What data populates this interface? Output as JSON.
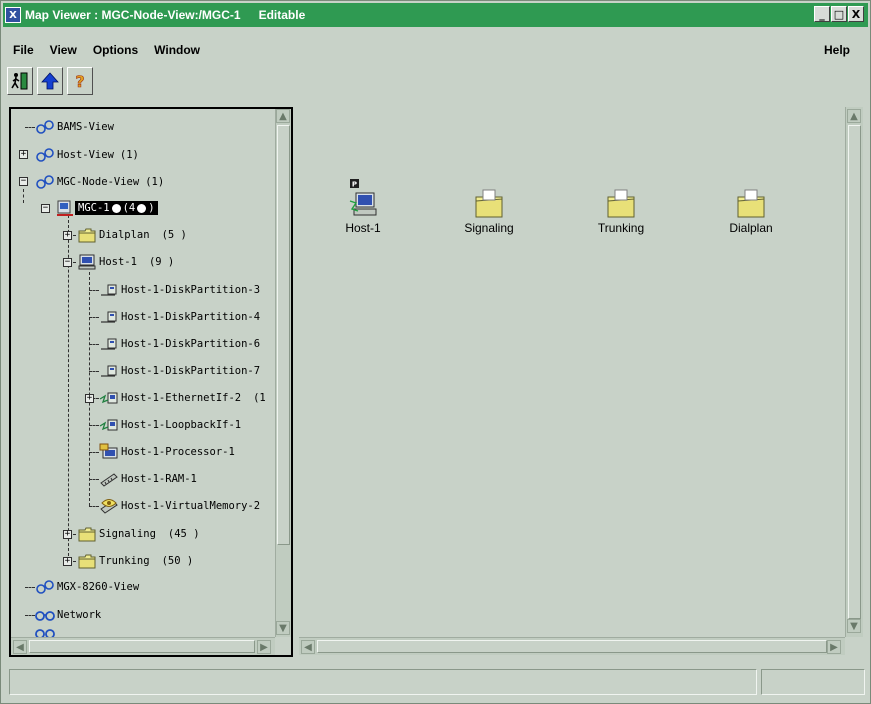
{
  "window": {
    "title": "Map Viewer : MGC-Node-View:/MGC-1",
    "status": "Editable",
    "logo": "X",
    "minimize": "_",
    "maximize": "□",
    "close": "X"
  },
  "menu": {
    "file": "File",
    "view": "View",
    "options": "Options",
    "window": "Window",
    "help": "Help"
  },
  "toolbar": {
    "items": [
      {
        "icon": "exit-icon"
      },
      {
        "icon": "up-arrow-icon"
      },
      {
        "icon": "help-icon"
      }
    ]
  },
  "tree": {
    "nodes": [
      {
        "label": "BAMS-View",
        "count": ""
      },
      {
        "label": "Host-View",
        "count": "(1)"
      },
      {
        "label": "MGC-Node-View",
        "count": "(1)"
      },
      {
        "label": "MGC-1",
        "count": "(4"
      },
      {
        "label": "Dialplan",
        "count": "(5  )"
      },
      {
        "label": "Host-1",
        "count": "(9  )"
      },
      {
        "label": "Host-1-DiskPartition-3",
        "count": ""
      },
      {
        "label": "Host-1-DiskPartition-4",
        "count": ""
      },
      {
        "label": "Host-1-DiskPartition-6",
        "count": ""
      },
      {
        "label": "Host-1-DiskPartition-7",
        "count": ""
      },
      {
        "label": "Host-1-EthernetIf-2",
        "count": "(1"
      },
      {
        "label": "Host-1-LoopbackIf-1",
        "count": ""
      },
      {
        "label": "Host-1-Processor-1",
        "count": ""
      },
      {
        "label": "Host-1-RAM-1",
        "count": ""
      },
      {
        "label": "Host-1-VirtualMemory-2",
        "count": ""
      },
      {
        "label": "Signaling",
        "count": "(45  )"
      },
      {
        "label": "Trunking",
        "count": "(50  )"
      },
      {
        "label": "MGX-8260-View",
        "count": ""
      },
      {
        "label": "Network",
        "count": ""
      }
    ]
  },
  "map": {
    "nodes": [
      {
        "label": "Host-1",
        "icon": "host-icon"
      },
      {
        "label": "Signaling",
        "icon": "folder-icon"
      },
      {
        "label": "Trunking",
        "icon": "folder-icon"
      },
      {
        "label": "Dialplan",
        "icon": "folder-icon"
      }
    ]
  },
  "status": {
    "text": ""
  },
  "colors": {
    "titlebar": "#2f9a52",
    "background": "#c8d2c8",
    "selection": "#000000"
  }
}
